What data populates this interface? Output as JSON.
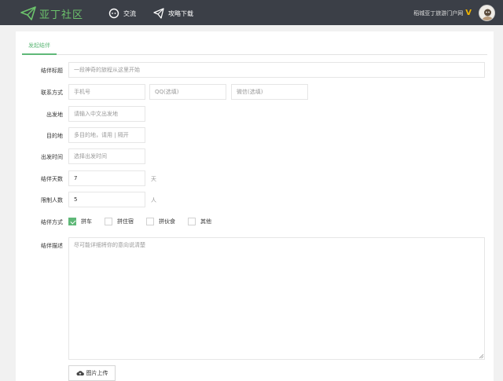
{
  "header": {
    "logo_text": "亚丁社区",
    "nav": [
      {
        "label": "交流",
        "icon": "chat-bubble-icon"
      },
      {
        "label": "攻略下载",
        "icon": "paper-plane-icon"
      }
    ],
    "site_link": "稻城亚丁旅游门户网",
    "badge": "V",
    "accent_color": "#6cc36c",
    "bar_color": "#3b3f47"
  },
  "tabs": [
    {
      "label": "发起结伴",
      "active": true
    }
  ],
  "form": {
    "title": {
      "label": "结伴标题",
      "placeholder": "一段神奇的旅程从这里开始",
      "value": ""
    },
    "contact": {
      "label": "联系方式",
      "phone_placeholder": "手机号",
      "qq_placeholder": "QQ(选填)",
      "wechat_placeholder": "微信(选填)"
    },
    "origin": {
      "label": "出发地",
      "placeholder": "请输入中文出发地"
    },
    "destination": {
      "label": "目的地",
      "placeholder": "多目的地，请用 | 隔开"
    },
    "depart_time": {
      "label": "出发时间",
      "placeholder": "选择出发时间"
    },
    "days": {
      "label": "结伴天数",
      "value": "7",
      "unit": "天"
    },
    "people": {
      "label": "限制人数",
      "value": "5",
      "unit": "人"
    },
    "mode": {
      "label": "结伴方式",
      "options": [
        {
          "label": "拼车",
          "checked": true
        },
        {
          "label": "拼住宿",
          "checked": false
        },
        {
          "label": "拼伙食",
          "checked": false
        },
        {
          "label": "其他",
          "checked": false
        }
      ]
    },
    "description": {
      "label": "结伴描述",
      "placeholder": "尽可能详细将你的意向说清楚"
    },
    "upload_label": "图片上传",
    "check_color": "#5fb878"
  }
}
